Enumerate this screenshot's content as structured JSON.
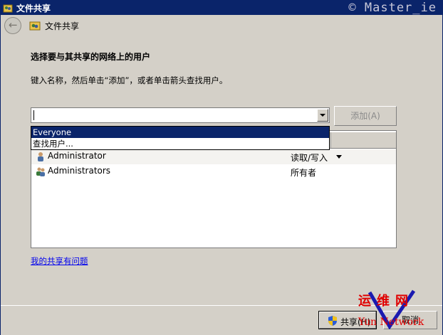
{
  "window": {
    "title": "文件共享",
    "watermark": "© Master_ie"
  },
  "nav": {
    "title": "文件共享"
  },
  "main": {
    "heading": "选择要与其共享的网络上的用户",
    "instruction": "键入名称，然后单击“添加”，或者单击箭头查找用户。",
    "combo_value": "",
    "add_button": "添加(A)",
    "dropdown_options": [
      "Everyone",
      "查找用户..."
    ],
    "users": [
      {
        "name": "Administrator",
        "permission": "读取/写入",
        "icon": "user-icon"
      },
      {
        "name": "Administrators",
        "permission": "所有者",
        "icon": "group-icon"
      }
    ],
    "help_link": "我的共享有问题"
  },
  "footer": {
    "share_button": "共享(H)",
    "cancel_button": "取消"
  },
  "logo": {
    "cn": "运维网",
    "en": "Yun Network"
  },
  "colors": {
    "titlebar": "#0a246a",
    "selected": "#0a246a",
    "logo_red": "#e00000",
    "logo_blue": "#1a1ab0"
  }
}
